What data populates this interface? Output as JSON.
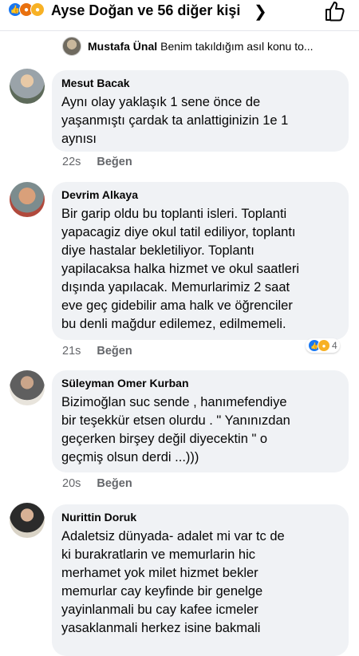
{
  "header": {
    "title": "Ayse Doğan ve 56 diğer kişi",
    "reactions": [
      "like",
      "angry",
      "sad"
    ]
  },
  "reply_preview": {
    "name": "Mustafa Ünal",
    "text": "Benim takıldığım asıl konu to..."
  },
  "comments": [
    {
      "name": "Mesut Bacak",
      "text": "Aynı olay yaklaşık 1 sene önce de\nyaşanmıştı çardak ta anlattiginizin 1e 1\naynısı",
      "time": "22s",
      "like_label": "Beğen"
    },
    {
      "name": "Devrim Alkaya",
      "text": "Bir garip oldu bu toplanti isleri. Toplanti\nyapacagiz diye okul tatil ediliyor, toplantı\ndiye hastalar bekletiliyor. Toplantı\nyapilacaksa halka hizmet ve okul saatleri\ndışında yapılacak.  Memurlarimiz 2 saat\neve geç gidebilir ama halk ve öğrenciler\nbu denli mağdur edilemez, edilmemeli.",
      "time": "21s",
      "like_label": "Beğen",
      "reaction_count": "4"
    },
    {
      "name": "Süleyman Omer Kurban",
      "text": "Bizimoğlan suc sende , hanımefendiye\nbir teşekkür etsen  olurdu . \" Yanınızdan\ngeçerken  birşey değil  diyecektin \"  o\ngeçmiş olsun derdi  ...)))",
      "time": "20s",
      "like_label": "Beğen"
    },
    {
      "name": "Nurittin Doruk",
      "text": "Adaletsiz  dünyada- adalet mi  var tc de\nki burakratlarin ve memurlarin hic\nmerhamet yok  milet hizmet bekler\nmemurlar cay keyfinde  bir genelge\nyayinlanmali bu cay kafee  icmeler\nyasaklanmali herkez isine bakmali",
      "time": "",
      "like_label": ""
    }
  ]
}
